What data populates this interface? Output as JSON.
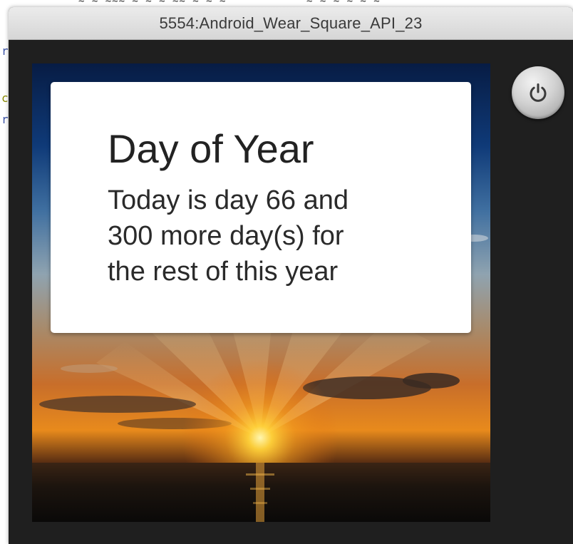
{
  "window": {
    "title": "5554:Android_Wear_Square_API_23"
  },
  "card": {
    "title": "Day of Year",
    "lines": [
      "Today is day 66 and",
      "300 more day(s) for",
      "the rest of this year"
    ]
  },
  "controls": {
    "power_icon": "power-icon"
  },
  "colors": {
    "titlebar": "#dedede",
    "emulator_frame": "#1f1f1f",
    "card_background": "#ffffff",
    "sun": "#ffcf3a"
  }
}
